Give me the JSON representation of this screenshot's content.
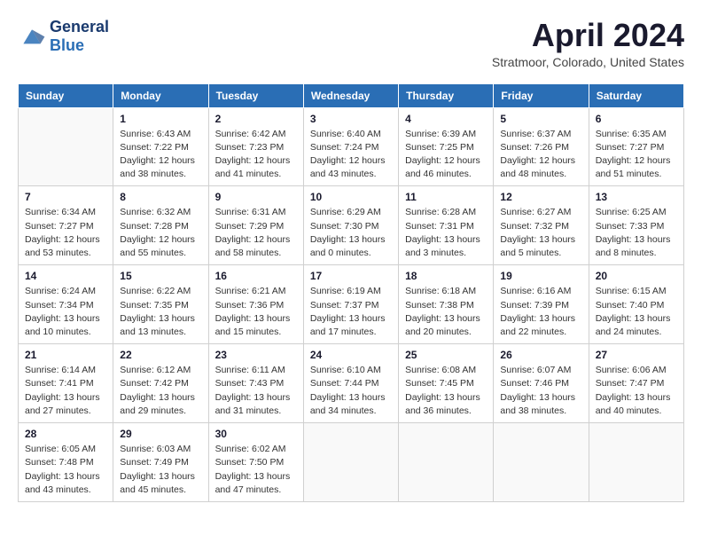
{
  "header": {
    "logo_line1": "General",
    "logo_line2": "Blue",
    "month_title": "April 2024",
    "location": "Stratmoor, Colorado, United States"
  },
  "days_of_week": [
    "Sunday",
    "Monday",
    "Tuesday",
    "Wednesday",
    "Thursday",
    "Friday",
    "Saturday"
  ],
  "weeks": [
    [
      {
        "day": "",
        "sunrise": "",
        "sunset": "",
        "daylight": ""
      },
      {
        "day": "1",
        "sunrise": "Sunrise: 6:43 AM",
        "sunset": "Sunset: 7:22 PM",
        "daylight": "Daylight: 12 hours and 38 minutes."
      },
      {
        "day": "2",
        "sunrise": "Sunrise: 6:42 AM",
        "sunset": "Sunset: 7:23 PM",
        "daylight": "Daylight: 12 hours and 41 minutes."
      },
      {
        "day": "3",
        "sunrise": "Sunrise: 6:40 AM",
        "sunset": "Sunset: 7:24 PM",
        "daylight": "Daylight: 12 hours and 43 minutes."
      },
      {
        "day": "4",
        "sunrise": "Sunrise: 6:39 AM",
        "sunset": "Sunset: 7:25 PM",
        "daylight": "Daylight: 12 hours and 46 minutes."
      },
      {
        "day": "5",
        "sunrise": "Sunrise: 6:37 AM",
        "sunset": "Sunset: 7:26 PM",
        "daylight": "Daylight: 12 hours and 48 minutes."
      },
      {
        "day": "6",
        "sunrise": "Sunrise: 6:35 AM",
        "sunset": "Sunset: 7:27 PM",
        "daylight": "Daylight: 12 hours and 51 minutes."
      }
    ],
    [
      {
        "day": "7",
        "sunrise": "Sunrise: 6:34 AM",
        "sunset": "Sunset: 7:27 PM",
        "daylight": "Daylight: 12 hours and 53 minutes."
      },
      {
        "day": "8",
        "sunrise": "Sunrise: 6:32 AM",
        "sunset": "Sunset: 7:28 PM",
        "daylight": "Daylight: 12 hours and 55 minutes."
      },
      {
        "day": "9",
        "sunrise": "Sunrise: 6:31 AM",
        "sunset": "Sunset: 7:29 PM",
        "daylight": "Daylight: 12 hours and 58 minutes."
      },
      {
        "day": "10",
        "sunrise": "Sunrise: 6:29 AM",
        "sunset": "Sunset: 7:30 PM",
        "daylight": "Daylight: 13 hours and 0 minutes."
      },
      {
        "day": "11",
        "sunrise": "Sunrise: 6:28 AM",
        "sunset": "Sunset: 7:31 PM",
        "daylight": "Daylight: 13 hours and 3 minutes."
      },
      {
        "day": "12",
        "sunrise": "Sunrise: 6:27 AM",
        "sunset": "Sunset: 7:32 PM",
        "daylight": "Daylight: 13 hours and 5 minutes."
      },
      {
        "day": "13",
        "sunrise": "Sunrise: 6:25 AM",
        "sunset": "Sunset: 7:33 PM",
        "daylight": "Daylight: 13 hours and 8 minutes."
      }
    ],
    [
      {
        "day": "14",
        "sunrise": "Sunrise: 6:24 AM",
        "sunset": "Sunset: 7:34 PM",
        "daylight": "Daylight: 13 hours and 10 minutes."
      },
      {
        "day": "15",
        "sunrise": "Sunrise: 6:22 AM",
        "sunset": "Sunset: 7:35 PM",
        "daylight": "Daylight: 13 hours and 13 minutes."
      },
      {
        "day": "16",
        "sunrise": "Sunrise: 6:21 AM",
        "sunset": "Sunset: 7:36 PM",
        "daylight": "Daylight: 13 hours and 15 minutes."
      },
      {
        "day": "17",
        "sunrise": "Sunrise: 6:19 AM",
        "sunset": "Sunset: 7:37 PM",
        "daylight": "Daylight: 13 hours and 17 minutes."
      },
      {
        "day": "18",
        "sunrise": "Sunrise: 6:18 AM",
        "sunset": "Sunset: 7:38 PM",
        "daylight": "Daylight: 13 hours and 20 minutes."
      },
      {
        "day": "19",
        "sunrise": "Sunrise: 6:16 AM",
        "sunset": "Sunset: 7:39 PM",
        "daylight": "Daylight: 13 hours and 22 minutes."
      },
      {
        "day": "20",
        "sunrise": "Sunrise: 6:15 AM",
        "sunset": "Sunset: 7:40 PM",
        "daylight": "Daylight: 13 hours and 24 minutes."
      }
    ],
    [
      {
        "day": "21",
        "sunrise": "Sunrise: 6:14 AM",
        "sunset": "Sunset: 7:41 PM",
        "daylight": "Daylight: 13 hours and 27 minutes."
      },
      {
        "day": "22",
        "sunrise": "Sunrise: 6:12 AM",
        "sunset": "Sunset: 7:42 PM",
        "daylight": "Daylight: 13 hours and 29 minutes."
      },
      {
        "day": "23",
        "sunrise": "Sunrise: 6:11 AM",
        "sunset": "Sunset: 7:43 PM",
        "daylight": "Daylight: 13 hours and 31 minutes."
      },
      {
        "day": "24",
        "sunrise": "Sunrise: 6:10 AM",
        "sunset": "Sunset: 7:44 PM",
        "daylight": "Daylight: 13 hours and 34 minutes."
      },
      {
        "day": "25",
        "sunrise": "Sunrise: 6:08 AM",
        "sunset": "Sunset: 7:45 PM",
        "daylight": "Daylight: 13 hours and 36 minutes."
      },
      {
        "day": "26",
        "sunrise": "Sunrise: 6:07 AM",
        "sunset": "Sunset: 7:46 PM",
        "daylight": "Daylight: 13 hours and 38 minutes."
      },
      {
        "day": "27",
        "sunrise": "Sunrise: 6:06 AM",
        "sunset": "Sunset: 7:47 PM",
        "daylight": "Daylight: 13 hours and 40 minutes."
      }
    ],
    [
      {
        "day": "28",
        "sunrise": "Sunrise: 6:05 AM",
        "sunset": "Sunset: 7:48 PM",
        "daylight": "Daylight: 13 hours and 43 minutes."
      },
      {
        "day": "29",
        "sunrise": "Sunrise: 6:03 AM",
        "sunset": "Sunset: 7:49 PM",
        "daylight": "Daylight: 13 hours and 45 minutes."
      },
      {
        "day": "30",
        "sunrise": "Sunrise: 6:02 AM",
        "sunset": "Sunset: 7:50 PM",
        "daylight": "Daylight: 13 hours and 47 minutes."
      },
      {
        "day": "",
        "sunrise": "",
        "sunset": "",
        "daylight": ""
      },
      {
        "day": "",
        "sunrise": "",
        "sunset": "",
        "daylight": ""
      },
      {
        "day": "",
        "sunrise": "",
        "sunset": "",
        "daylight": ""
      },
      {
        "day": "",
        "sunrise": "",
        "sunset": "",
        "daylight": ""
      }
    ]
  ]
}
